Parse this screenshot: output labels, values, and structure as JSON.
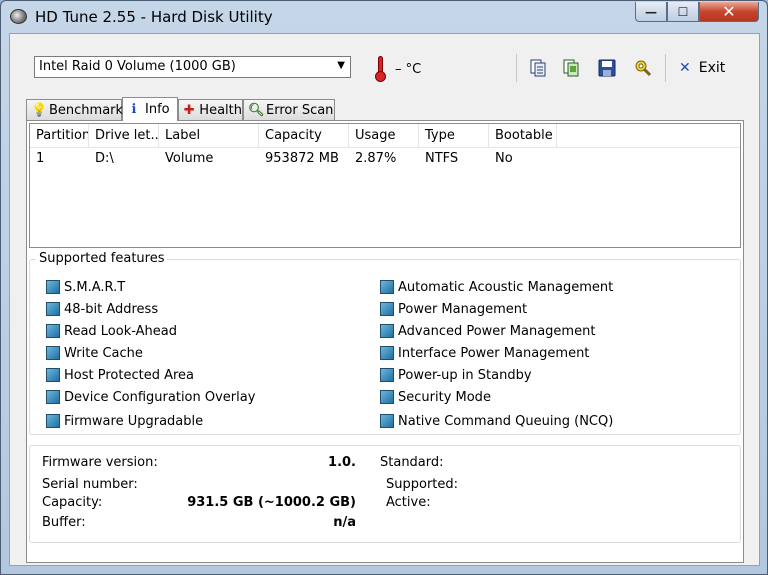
{
  "window": {
    "title": "HD Tune 2.55 - Hard Disk Utility",
    "minimize_symbol": "—",
    "maximize_symbol": "☐",
    "close_symbol": "✕"
  },
  "toolbar": {
    "drive": "Intel   Raid 0 Volume (1000 GB)",
    "temperature": "– °C",
    "exit_label": "Exit",
    "icons": [
      "copy-text-icon",
      "copy-screenshot-icon",
      "save-icon",
      "options-icon"
    ]
  },
  "tabs": [
    {
      "label": "Benchmark",
      "icon": "lightbulb-icon",
      "active": false
    },
    {
      "label": "Info",
      "icon": "info-icon",
      "active": true
    },
    {
      "label": "Health",
      "icon": "red-cross-icon",
      "active": false
    },
    {
      "label": "Error Scan",
      "icon": "magnifier-icon",
      "active": false
    }
  ],
  "partitions": {
    "columns": [
      "Partition",
      "Drive let...",
      "Label",
      "Capacity",
      "Usage",
      "Type",
      "Bootable"
    ],
    "rows": [
      [
        "1",
        "D:\\",
        "Volume",
        "953872 MB",
        "2.87%",
        "NTFS",
        "No"
      ]
    ]
  },
  "features": {
    "title": "Supported features",
    "left": [
      "S.M.A.R.T",
      "48-bit Address",
      "Read Look-Ahead",
      "Write Cache",
      "Host Protected Area",
      "Device Configuration Overlay",
      "Firmware Upgradable"
    ],
    "right": [
      "Automatic Acoustic Management",
      "Power Management",
      "Advanced Power Management",
      "Interface Power Management",
      "Power-up in Standby",
      "Security Mode",
      "Native Command Queuing (NCQ)"
    ]
  },
  "details": {
    "firmware_label": "Firmware version:",
    "firmware_value": "1.0.",
    "serial_label": "Serial number:",
    "serial_value": "",
    "capacity_label": "Capacity:",
    "capacity_value": "931.5 GB (~1000.2 GB)",
    "buffer_label": "Buffer:",
    "buffer_value": "n/a",
    "standard_label": "Standard:",
    "supported_label": "Supported:",
    "active_label": "Active:"
  }
}
